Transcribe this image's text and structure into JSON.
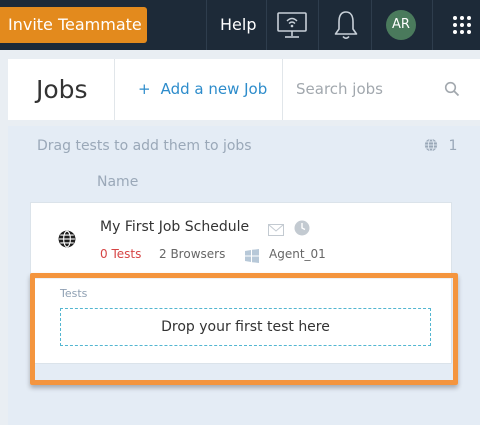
{
  "topbar": {
    "invite_label": "Invite Teammate",
    "help_label": "Help",
    "user_initials": "AR",
    "icons": [
      "remote-display-icon",
      "notification-bell-icon",
      "app-grid-icon"
    ]
  },
  "header": {
    "title": "Jobs",
    "add_job_label": "Add a new Job",
    "add_job_icon": "+",
    "search_placeholder": "Search jobs"
  },
  "content": {
    "drag_hint": "Drag tests to add them to jobs",
    "job_count": "1",
    "name_column": "Name"
  },
  "job": {
    "name": "My First Job Schedule",
    "tests": "0 Tests",
    "browsers": "2 Browsers",
    "agent": "Agent_01",
    "tests_section_label": "Tests",
    "drop_placeholder": "Drop your first test here"
  },
  "colors": {
    "topbar_bg": "#1d2a38",
    "invite_button": "#e38a1d",
    "accent_link": "#2d8ccb",
    "tests_count_red": "#d64545",
    "highlight_outline": "#f4953e",
    "drop_zone_border": "#53b6d1"
  }
}
